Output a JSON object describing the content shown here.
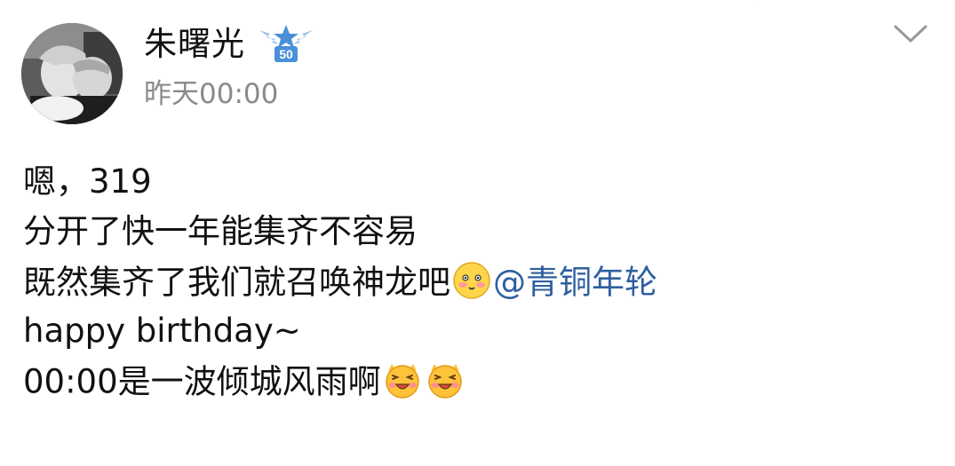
{
  "post": {
    "author_name": "朱曙光",
    "time": "昨天00:00",
    "badge_text": "50",
    "icons": {
      "avatar": "user-photo-avatar",
      "badge": "star-wings-badge-icon",
      "menu": "chevron-down-icon",
      "emoji_1": "shy-smile-emoji-icon",
      "emoji_2": "laughing-face-emoji-icon"
    },
    "content": {
      "line1": "嗯，319",
      "line2": "分开了快一年能集齐不容易",
      "line3_text": "既然集齐了我们就召唤神龙吧",
      "line3_mention": "@青铜年轮",
      "line4": "happy birthday~",
      "line5": "00:00是一波倾城风雨啊"
    }
  },
  "colors": {
    "mention": "#2e5f9f",
    "time": "#8a8a8a",
    "text": "#111111",
    "badge_blue": "#4a90d9"
  }
}
